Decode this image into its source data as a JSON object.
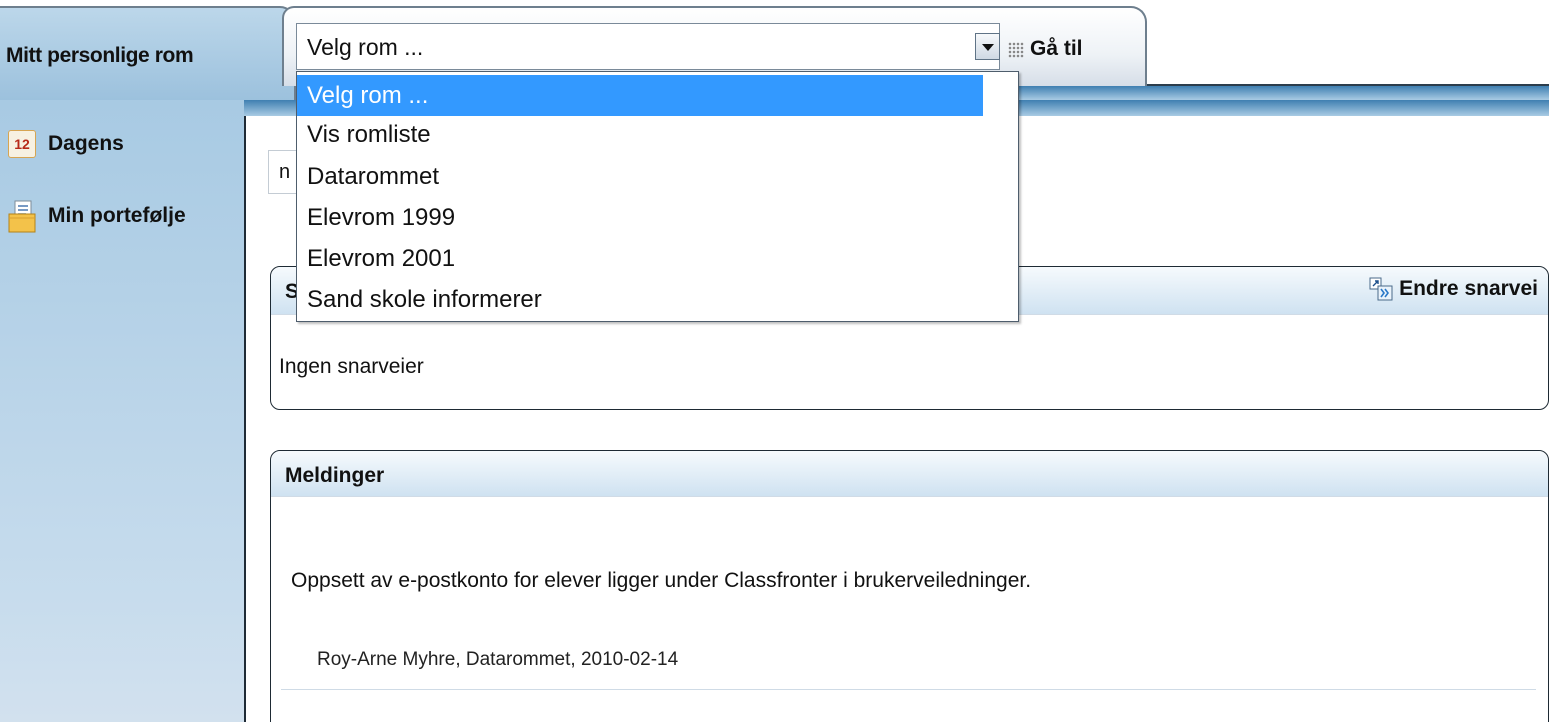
{
  "header": {
    "personal_tab_label": "Mitt personlige rom",
    "room_select_value": "Velg rom ...",
    "goto_label": "Gå til"
  },
  "dropdown": {
    "options": [
      "Velg rom ...",
      "Vis romliste",
      "Datarommet",
      "Elevrom 1999",
      "Elevrom 2001",
      "Sand skole informerer"
    ],
    "selected_index": 0
  },
  "sidebar": {
    "items": [
      {
        "label": "Dagens",
        "icon": "calendar-icon",
        "icon_text": "12"
      },
      {
        "label": "Min portefølje",
        "icon": "portfolio-icon"
      }
    ]
  },
  "main": {
    "search_stub_text": "n",
    "shortcuts_panel": {
      "title_partial": "S",
      "edit_label": "Endre snarvei",
      "empty_text": "Ingen snarveier"
    },
    "messages_panel": {
      "title": "Meldinger",
      "messages": [
        {
          "text": "Oppsett av e-postkonto for elever ligger under Classfronter i brukerveiledninger.",
          "meta": "Roy-Arne Myhre,  Datarommet,  2010-02-14"
        }
      ]
    }
  },
  "colors": {
    "sidebar_bg": "#a8cae3",
    "accent_blue": "#3399ff",
    "strip_blue": "#3f7fb1"
  }
}
